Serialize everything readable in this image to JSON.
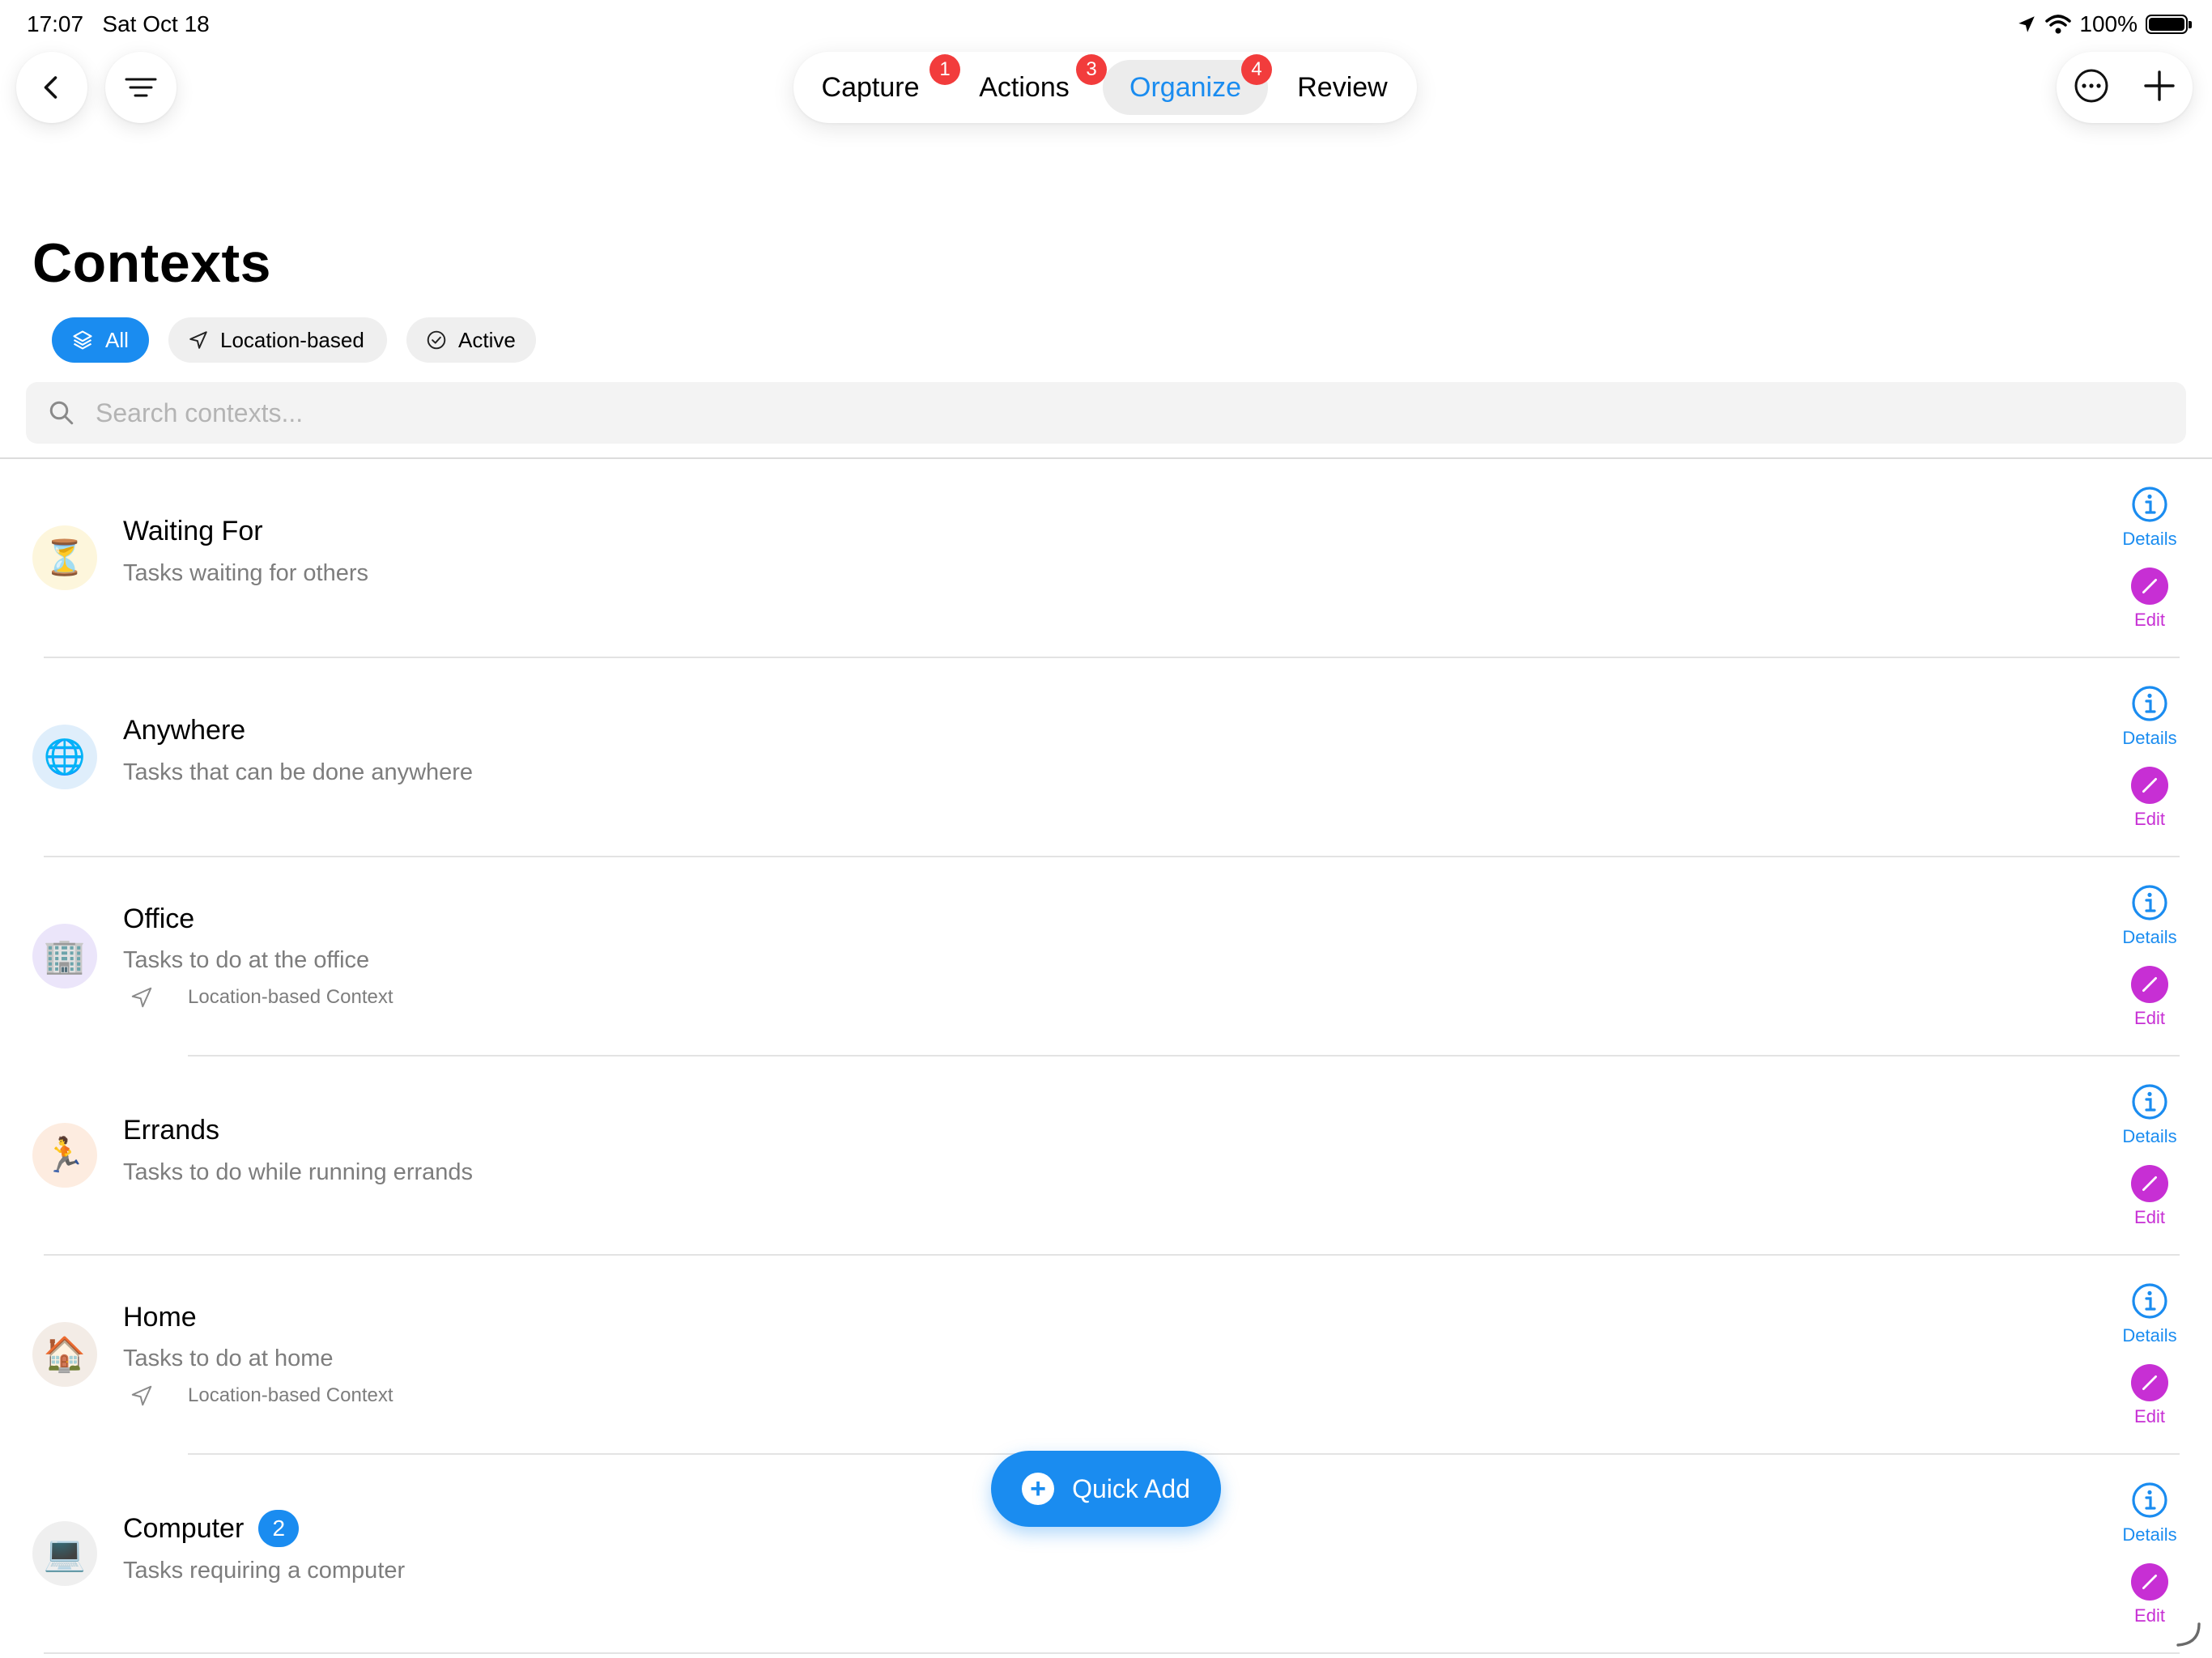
{
  "status_bar": {
    "time": "17:07",
    "date": "Sat Oct 18",
    "battery": "100%"
  },
  "nav": {
    "back_icon": "chevron-left-icon",
    "filter_icon": "filter-lines-icon",
    "more_icon": "ellipsis-circle-icon",
    "add_icon": "plus-icon"
  },
  "tabs": [
    {
      "label": "Capture",
      "badge": "1"
    },
    {
      "label": "Actions",
      "badge": "3"
    },
    {
      "label": "Organize",
      "badge": "4",
      "active": true
    },
    {
      "label": "Review"
    }
  ],
  "page": {
    "title": "Contexts"
  },
  "filters": [
    {
      "label": "All",
      "icon": "layers-icon",
      "selected": true
    },
    {
      "label": "Location-based",
      "icon": "location-arrow-icon"
    },
    {
      "label": "Active",
      "icon": "check-circle-icon"
    }
  ],
  "search": {
    "placeholder": "Search contexts...",
    "value": ""
  },
  "actions": {
    "details_label": "Details",
    "edit_label": "Edit"
  },
  "contexts": [
    {
      "name": "Waiting For",
      "description": "Tasks waiting for others",
      "emoji": "⏳",
      "bg": "#fdf6dc"
    },
    {
      "name": "Anywhere",
      "description": "Tasks that can be done anywhere",
      "emoji": "🌐",
      "bg": "#dfeefb"
    },
    {
      "name": "Office",
      "description": "Tasks to do at the office",
      "emoji": "🏢",
      "bg": "#ebe5fa",
      "location_label": "Location-based Context"
    },
    {
      "name": "Errands",
      "description": "Tasks to do while running errands",
      "emoji": "🏃",
      "bg": "#fdece0"
    },
    {
      "name": "Home",
      "description": "Tasks to do at home",
      "emoji": "🏠",
      "bg": "#f3ece6",
      "location_label": "Location-based Context"
    },
    {
      "name": "Computer",
      "description": "Tasks requiring a computer",
      "emoji": "💻",
      "bg": "#efefef",
      "count": "2"
    }
  ],
  "quick_add": {
    "label": "Quick Add"
  },
  "colors": {
    "accent": "#1a8cf0",
    "edit": "#c72fd4",
    "badge_red": "#f23c3c"
  }
}
